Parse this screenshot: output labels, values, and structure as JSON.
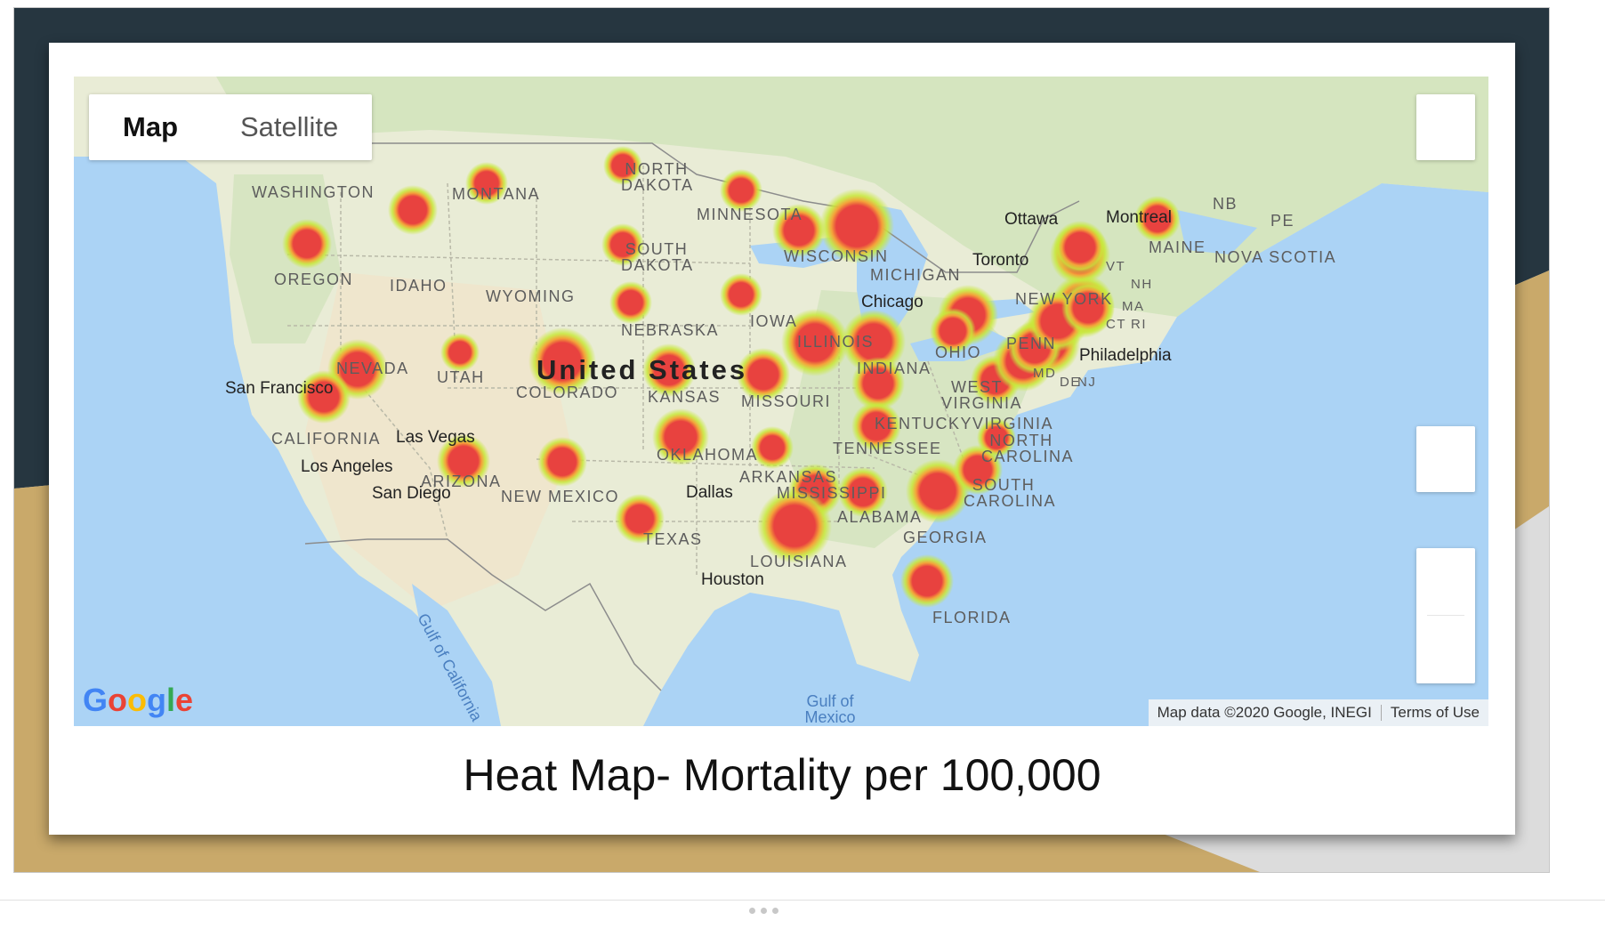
{
  "map_controls": {
    "map_label": "Map",
    "satellite_label": "Satellite"
  },
  "logo_text": "Google",
  "attribution": {
    "map_data": "Map data ©2020 Google, INEGI",
    "terms": "Terms of Use"
  },
  "caption": "Heat Map- Mortality per 100,000",
  "map_labels": {
    "country": "United States",
    "states": [
      "WASHINGTON",
      "MONTANA",
      "NORTH DAKOTA",
      "MINNESOTA",
      "OREGON",
      "IDAHO",
      "SOUTH DAKOTA",
      "WYOMING",
      "WISCONSIN",
      "MICHIGAN",
      "NEBRASKA",
      "IOWA",
      "ILLINOIS",
      "NEVADA",
      "UTAH",
      "COLORADO",
      "KANSAS",
      "MISSOURI",
      "INDIANA",
      "OHIO",
      "PENN",
      "WEST VIRGINIA",
      "VIRGINIA",
      "KENTUCKY",
      "CALIFORNIA",
      "ARIZONA",
      "NEW MEXICO",
      "OKLAHOMA",
      "ARKANSAS",
      "TENNESSEE",
      "NORTH CAROLINA",
      "SOUTH CAROLINA",
      "MISSISSIPPI",
      "ALABAMA",
      "GEORGIA",
      "TEXAS",
      "LOUISIANA",
      "FLORIDA",
      "NEW YORK",
      "MAINE",
      "NB",
      "PE",
      "NOVA SCOTIA",
      "MD",
      "DE",
      "NJ",
      "VT",
      "NH",
      "MA",
      "CT",
      "RI"
    ],
    "cities": [
      "Ottawa",
      "Montreal",
      "Toronto",
      "Chicago",
      "Philadelphia",
      "San Francisco",
      "Las Vegas",
      "Los Angeles",
      "San Diego",
      "Dallas",
      "Houston"
    ],
    "water": [
      "Gulf of Mexico",
      "Gulf of California"
    ]
  },
  "colors": {
    "hotspot_core": "#e8423f",
    "hotspot_halo": "#c8e83a",
    "water": "#abd3f5",
    "land": "#e9ecd6"
  },
  "icons": [
    "fullscreen-icon",
    "pegman-icon",
    "zoom-in-icon",
    "zoom-out-icon"
  ]
}
